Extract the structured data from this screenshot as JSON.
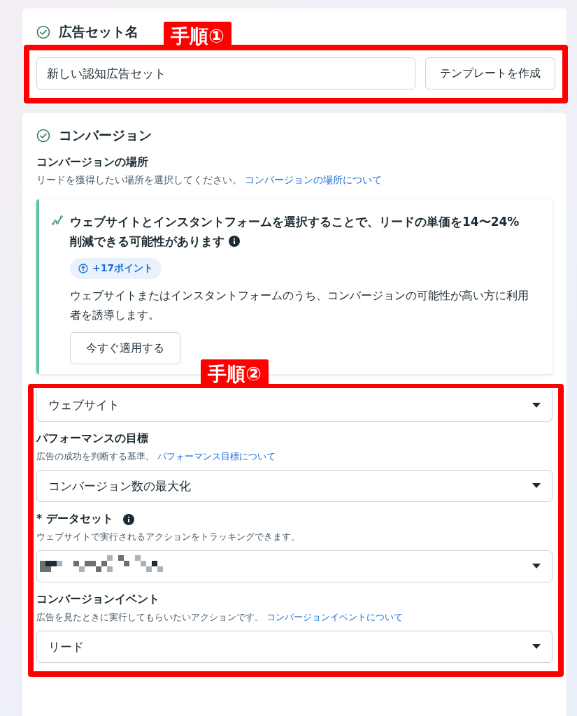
{
  "ad_set_name": {
    "title": "広告セット名",
    "completed": true,
    "value": "新しい認知広告セット",
    "template_button": "テンプレートを作成"
  },
  "conversion": {
    "title": "コンバージョン",
    "completed": true,
    "location_label": "コンバージョンの場所",
    "location_help": "リードを獲得したい場所を選択してください。",
    "location_link": "コンバージョンの場所について",
    "recommendation": {
      "title": "ウェブサイトとインスタントフォームを選択することで、リードの単価を14〜24%削減できる可能性があります",
      "info": true,
      "badge": "+17ポイント",
      "body": "ウェブサイトまたはインスタントフォームのうち、コンバージョンの可能性が高い方に利用者を誘導します。",
      "apply_button": "今すぐ適用する"
    },
    "fields": [
      {
        "kind": "select",
        "value": "ウェブサイト"
      },
      {
        "kind": "select",
        "label": "パフォーマンスの目標",
        "help": "広告の成功を判断する基準。",
        "link": "パフォーマンス目標について",
        "value": "コンバージョン数の最大化"
      },
      {
        "kind": "select",
        "label": "* データセット",
        "info": true,
        "help": "ウェブサイトで実行されるアクションをトラッキングできます。",
        "redacted": true
      },
      {
        "kind": "select",
        "label": "コンバージョンイベント",
        "help": "広告を見たときに実行してもらいたいアクションです。",
        "link": "コンバージョンイベントについて",
        "value": "リード"
      }
    ]
  },
  "annotations": [
    {
      "label": "手順①"
    },
    {
      "label": "手順②"
    }
  ]
}
